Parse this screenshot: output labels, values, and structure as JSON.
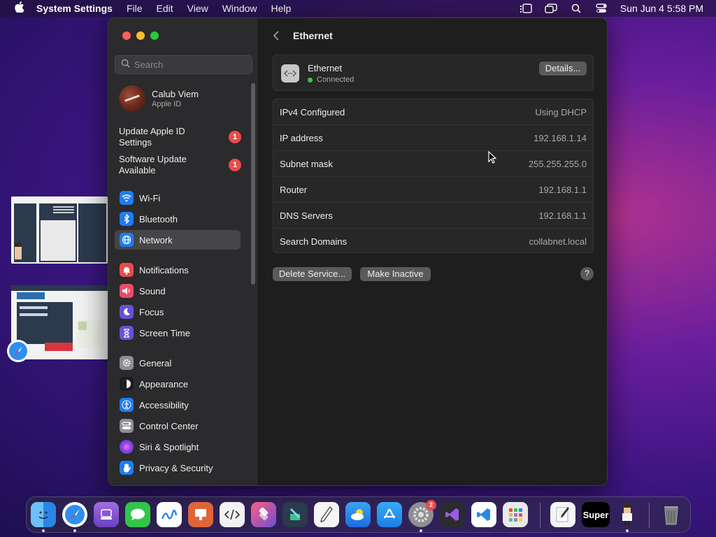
{
  "menubar": {
    "app_name": "System Settings",
    "items": [
      "File",
      "Edit",
      "View",
      "Window",
      "Help"
    ],
    "clock": "Sun Jun 4  5:58 PM"
  },
  "sidebar": {
    "search_placeholder": "Search",
    "profile": {
      "name": "Calub Viem",
      "subtitle": "Apple ID"
    },
    "alerts": [
      {
        "label": "Update Apple ID Settings",
        "badge": "1"
      },
      {
        "label": "Software Update Available",
        "badge": "1"
      }
    ],
    "items": [
      {
        "label": "Wi-Fi",
        "icon": "wifi-icon",
        "color": "#1e7cf5"
      },
      {
        "label": "Bluetooth",
        "icon": "bluetooth-icon",
        "color": "#1e7cf5"
      },
      {
        "label": "Network",
        "icon": "globe-icon",
        "color": "#1e7cf5"
      },
      {
        "label": "Notifications",
        "icon": "bell-icon",
        "color": "#ea4b4b"
      },
      {
        "label": "Sound",
        "icon": "speaker-icon",
        "color": "#ea4b6a"
      },
      {
        "label": "Focus",
        "icon": "moon-icon",
        "color": "#6a4fd8"
      },
      {
        "label": "Screen Time",
        "icon": "hourglass-icon",
        "color": "#6a4fd8"
      },
      {
        "label": "General",
        "icon": "gear-icon",
        "color": "#8e8e93"
      },
      {
        "label": "Appearance",
        "icon": "appearance-icon",
        "color": "#1c1c1e"
      },
      {
        "label": "Accessibility",
        "icon": "accessibility-icon",
        "color": "#1e7cf5"
      },
      {
        "label": "Control Center",
        "icon": "control-center-icon",
        "color": "#8e8e93"
      },
      {
        "label": "Siri & Spotlight",
        "icon": "siri-icon",
        "color": "#c33fd8"
      },
      {
        "label": "Privacy & Security",
        "icon": "hand-icon",
        "color": "#1e7cf5"
      }
    ]
  },
  "main": {
    "title": "Ethernet",
    "service": {
      "name": "Ethernet",
      "status": "Connected",
      "details_label": "Details..."
    },
    "rows": [
      {
        "label": "IPv4 Configured",
        "value": "Using DHCP"
      },
      {
        "label": "IP address",
        "value": "192.168.1.14"
      },
      {
        "label": "Subnet mask",
        "value": "255.255.255.0"
      },
      {
        "label": "Router",
        "value": "192.168.1.1"
      },
      {
        "label": "DNS Servers",
        "value": "192.168.1.1"
      },
      {
        "label": "Search Domains",
        "value": "collabnet.local"
      }
    ],
    "delete_label": "Delete Service...",
    "inactive_label": "Make Inactive",
    "help_label": "?"
  },
  "dock": {
    "super_label": "Super",
    "settings_badge": "2"
  }
}
